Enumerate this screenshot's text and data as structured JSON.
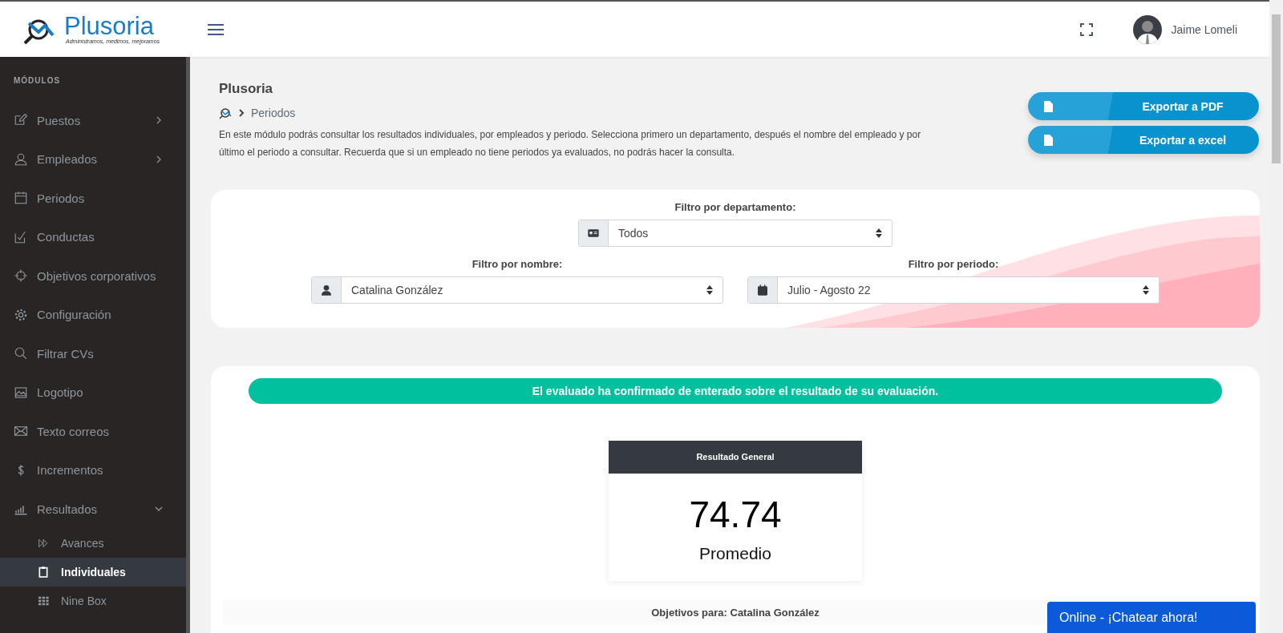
{
  "header": {
    "logo_name": "Plusoria",
    "logo_tagline": "Administramos, medimos, mejoramos",
    "user_name": "Jaime Lomeli"
  },
  "sidebar": {
    "section_title": "MÓDULOS",
    "items": [
      {
        "label": "Puestos",
        "selected": false,
        "expanded": false
      },
      {
        "label": "Empleados",
        "selected": false,
        "expanded": false
      },
      {
        "label": "Periodos",
        "selected": false
      },
      {
        "label": "Conductas",
        "selected": false
      },
      {
        "label": "Objetivos corporativos",
        "selected": false
      },
      {
        "label": "Configuración",
        "selected": false
      },
      {
        "label": "Filtrar CVs",
        "selected": false
      },
      {
        "label": "Logotipo",
        "selected": false
      },
      {
        "label": "Texto correos",
        "selected": false
      },
      {
        "label": "Incrementos",
        "selected": false
      },
      {
        "label": "Resultados",
        "selected": false,
        "expanded": true,
        "children": [
          {
            "label": "Avances",
            "selected": false
          },
          {
            "label": "Individuales",
            "selected": true
          },
          {
            "label": "Nine Box",
            "selected": false
          }
        ]
      }
    ]
  },
  "page": {
    "title": "Plusoria",
    "breadcrumb": "Periodos",
    "description": "En este módulo podrás consultar los resultados individuales, por empleados y periodo. Selecciona primero un departamento, después el nombre del empleado y por último el periodo a consultar. Recuerda que si un empleado no tiene periodos ya evaluados, no podrás hacer la consulta.",
    "export_buttons": [
      "Exportar a PDF",
      "Exportar a excel"
    ]
  },
  "filters": [
    {
      "label": "Filtro por departamento:",
      "value": "Todos"
    },
    {
      "label": "Filtro por nombre:",
      "value": "Catalina González"
    },
    {
      "label": "Filtro por periodo:",
      "value": "Julio - Agosto 22"
    }
  ],
  "result": {
    "banner": "El evaluado ha confirmado de enterado sobre el resultado de su evaluación.",
    "card_title": "Resultado General",
    "score": "74.74",
    "score_label": "Promedio",
    "objectives_title": "Objetivos para: Catalina González"
  },
  "chat_button": "Online - ¡Chatear ahora!"
}
